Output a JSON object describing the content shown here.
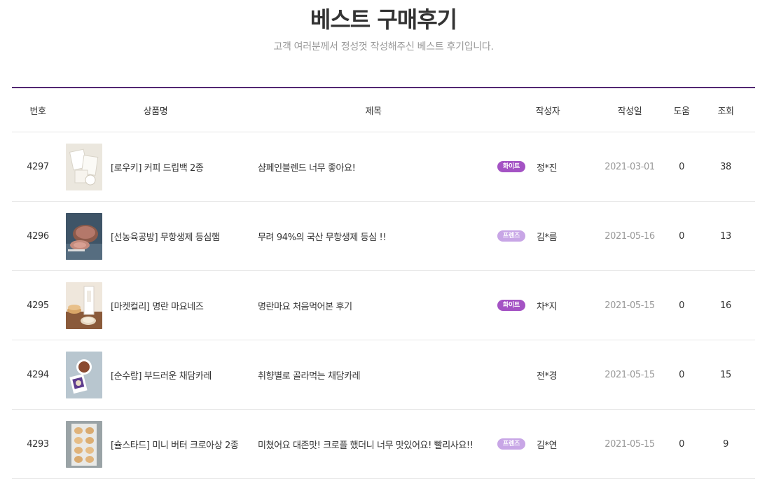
{
  "header": {
    "title": "베스트 구매후기",
    "subtitle": "고객 여러분께서 정성껏 작성해주신 베스트 후기입니다."
  },
  "table": {
    "columns": {
      "no": "번호",
      "product": "상품명",
      "title": "제목",
      "writer": "작성자",
      "date": "작성일",
      "help": "도움",
      "views": "조회"
    },
    "rows": [
      {
        "no": "4297",
        "product": "[로우키] 커피 드립백 2종",
        "title": "샴페인블렌드 너무 좋아요!",
        "badge": "화이트",
        "badge_type": "white",
        "writer": "정*진",
        "date": "2021-03-01",
        "help": "0",
        "views": "38",
        "thumb_icon": "coffee-dripbag-thumbnail"
      },
      {
        "no": "4296",
        "product": "[선농육공방] 무항생제 등심햄",
        "title": "무려 94%의 국산 무항생제 등심 !!",
        "badge": "프렌즈",
        "badge_type": "friends",
        "writer": "김*름",
        "date": "2021-05-16",
        "help": "0",
        "views": "13",
        "thumb_icon": "ham-thumbnail"
      },
      {
        "no": "4295",
        "product": "[마켓컬리] 명란 마요네즈",
        "title": "명란마요 처음먹어본 후기",
        "badge": "화이트",
        "badge_type": "white",
        "writer": "차*지",
        "date": "2021-05-15",
        "help": "0",
        "views": "16",
        "thumb_icon": "mayonnaise-thumbnail"
      },
      {
        "no": "4294",
        "product": "[순수람] 부드러운 채담카레",
        "title": "취향별로 골라먹는 채담카레",
        "badge": "",
        "badge_type": "none",
        "writer": "전*경",
        "date": "2021-05-15",
        "help": "0",
        "views": "15",
        "thumb_icon": "curry-thumbnail"
      },
      {
        "no": "4293",
        "product": "[슐스타드] 미니 버터 크로아상 2종",
        "title": "미쳤어요 대존맛! 크로플 했더니 너무 맛있어요! 빨리사요!!",
        "badge": "프렌즈",
        "badge_type": "friends",
        "writer": "김*연",
        "date": "2021-05-15",
        "help": "0",
        "views": "9",
        "thumb_icon": "croissant-thumbnail"
      }
    ]
  },
  "colors": {
    "accent": "#522772",
    "badge_white": "#a453c4",
    "badge_friends": "#c8a6e6",
    "muted_text": "#999999",
    "divider": "#e6e6e6"
  }
}
